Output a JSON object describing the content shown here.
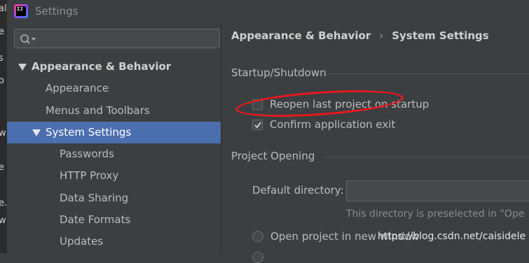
{
  "window": {
    "title": "Settings"
  },
  "ide_strip": [
    "al",
    "e",
    "s",
    "o",
    "w",
    "e",
    "e.j",
    "w"
  ],
  "tree": {
    "items": [
      {
        "label": "Appearance & Behavior",
        "bold": true,
        "expanded": true
      },
      {
        "label": "Appearance"
      },
      {
        "label": "Menus and Toolbars"
      },
      {
        "label": "System Settings",
        "selected": true,
        "expanded": true
      },
      {
        "label": "Passwords"
      },
      {
        "label": "HTTP Proxy"
      },
      {
        "label": "Data Sharing"
      },
      {
        "label": "Date Formats"
      },
      {
        "label": "Updates"
      }
    ]
  },
  "breadcrumb": {
    "parent": "Appearance & Behavior",
    "separator": "›",
    "current": "System Settings"
  },
  "startup": {
    "section": "Startup/Shutdown",
    "reopen_label": "Reopen last project on startup",
    "reopen_checked": false,
    "confirm_label": "Confirm application exit",
    "confirm_checked": true
  },
  "project_opening": {
    "section": "Project Opening",
    "default_dir_label": "Default directory:",
    "default_dir_value": "",
    "hint": "This directory is preselected in \"Ope",
    "radio_new_window": "Open project in new window"
  },
  "watermark": "https://blog.csdn.net/caisidele",
  "colors": {
    "selection": "#4b6eaf",
    "annotation": "#e8191e",
    "background": "#3c3f41"
  }
}
